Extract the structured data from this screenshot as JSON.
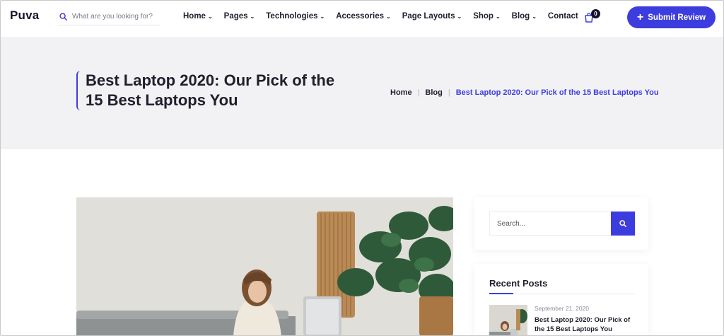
{
  "header": {
    "logo": "Puva",
    "search_placeholder": "What are you looking for?",
    "nav": [
      {
        "label": "Home",
        "has_dropdown": true
      },
      {
        "label": "Pages",
        "has_dropdown": true
      },
      {
        "label": "Technologies",
        "has_dropdown": true
      },
      {
        "label": "Accessories",
        "has_dropdown": true
      },
      {
        "label": "Page Layouts",
        "has_dropdown": true
      },
      {
        "label": "Shop",
        "has_dropdown": true
      },
      {
        "label": "Blog",
        "has_dropdown": true
      },
      {
        "label": "Contact",
        "has_dropdown": false
      }
    ],
    "cart_count": "0",
    "submit_label": "Submit Review"
  },
  "banner": {
    "title": "Best Laptop 2020: Our Pick of the 15 Best Laptops You",
    "breadcrumb": [
      "Home",
      "Blog"
    ],
    "breadcrumb_current": "Best Laptop 2020: Our Pick of the 15 Best Laptops You"
  },
  "sidebar": {
    "search_placeholder": "Search...",
    "recent_title": "Recent Posts",
    "recent_posts": [
      {
        "date": "September 21, 2020",
        "title": "Best Laptop 2020: Our Pick of the 15 Best Laptops You"
      }
    ]
  },
  "colors": {
    "accent": "#3d3ddf",
    "banner_bg": "#f2f2f4",
    "text_dark": "#1f1f2e"
  },
  "icons": {
    "search": "search-icon",
    "cart": "cart-icon",
    "plus": "plus-icon",
    "chevron": "chevron-down-icon"
  }
}
